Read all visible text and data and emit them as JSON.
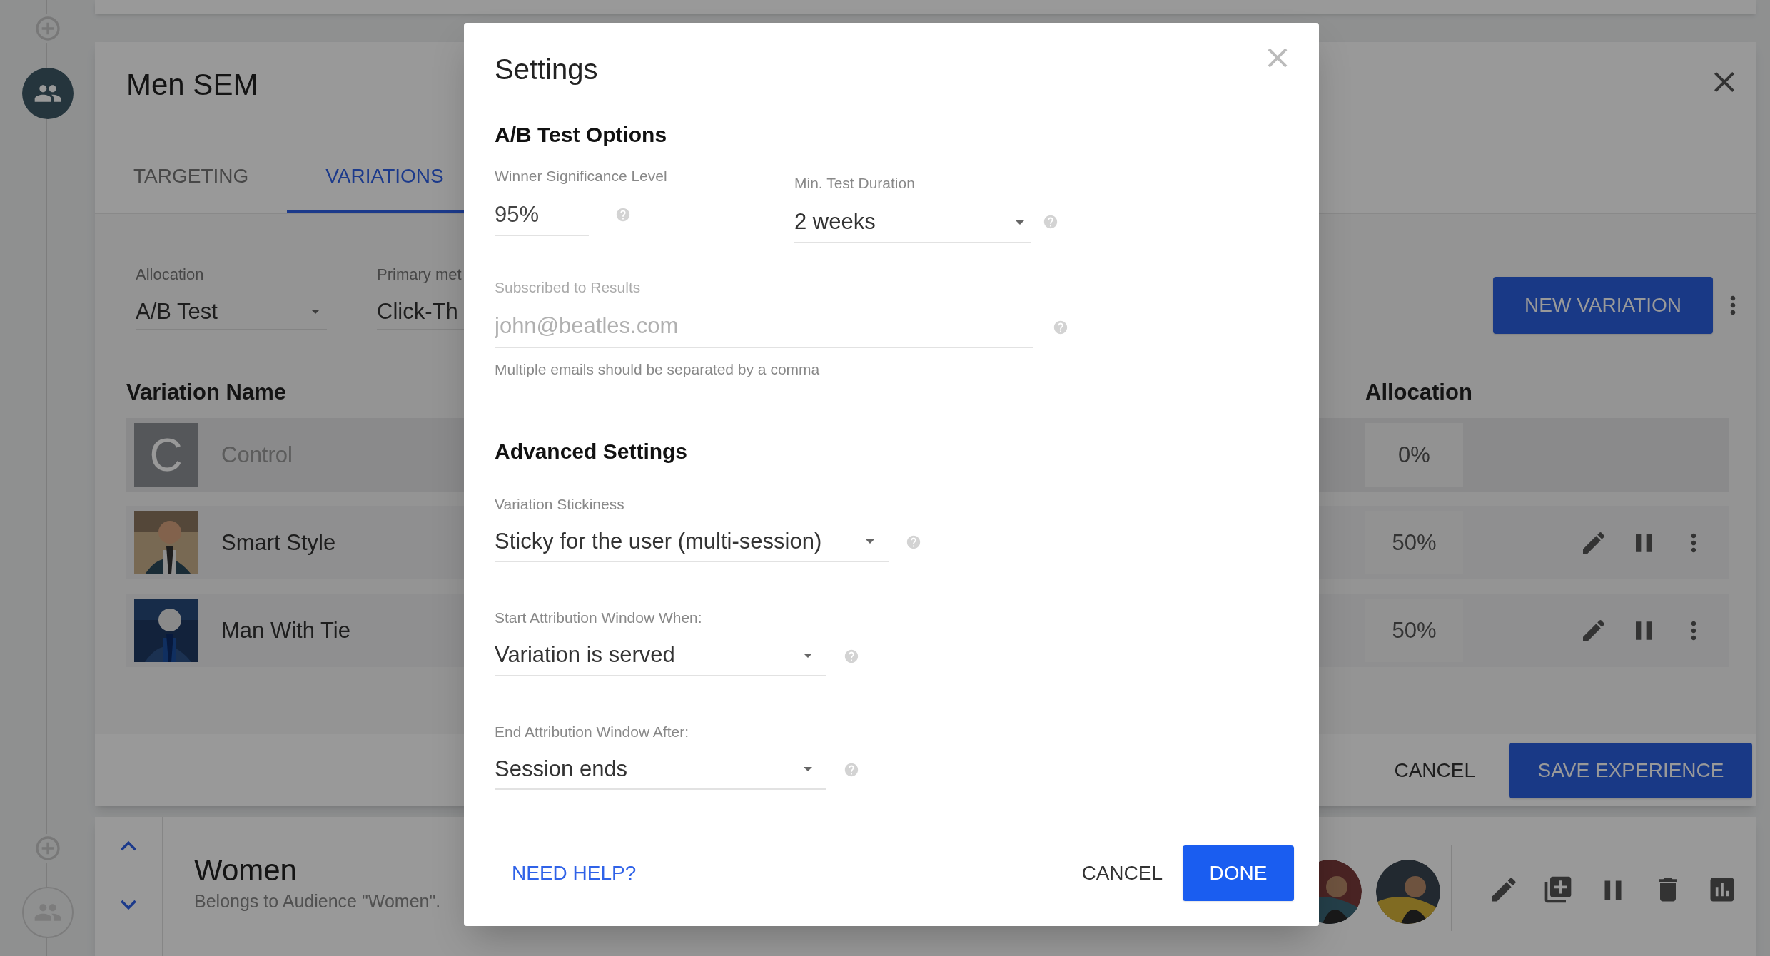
{
  "experience": {
    "title": "Men SEM",
    "tabs": [
      {
        "label": "TARGETING",
        "selected": false
      },
      {
        "label": "VARIATIONS",
        "selected": true
      }
    ],
    "allocation_field": {
      "label": "Allocation",
      "value": "A/B Test"
    },
    "primary_metric_field": {
      "label": "Primary met",
      "value": "Click-Th"
    },
    "new_variation_button": "NEW VARIATION",
    "columns": [
      "Variation Name",
      "Allocation"
    ],
    "variations": [
      {
        "name": "Control",
        "kind": "letter",
        "letter": "C",
        "allocation": "0%",
        "disabled": true
      },
      {
        "name": "Smart Style",
        "kind": "picture",
        "allocation": "50%",
        "disabled": false
      },
      {
        "name": "Man With Tie",
        "kind": "picture",
        "allocation": "50%",
        "disabled": false
      }
    ],
    "cancel_button": "CANCEL",
    "save_button": "SAVE EXPERIENCE"
  },
  "next_experience": {
    "title": "Women",
    "subtitle": "Belongs to Audience \"Women\"."
  },
  "dialog": {
    "title": "Settings",
    "ab_section": {
      "heading": "A/B Test Options",
      "significance": {
        "label": "Winner Significance Level",
        "value": "95%"
      },
      "duration": {
        "label": "Min. Test Duration",
        "value": "2 weeks"
      },
      "subscribers": {
        "label": "Subscribed to Results",
        "placeholder": "john@beatles.com",
        "hint": "Multiple emails should be separated by a comma"
      }
    },
    "advanced_section": {
      "heading": "Advanced Settings",
      "fields": [
        {
          "label": "Variation Stickiness",
          "value": "Sticky for the user (multi-session)"
        },
        {
          "label": "Start Attribution Window When:",
          "value": "Variation is served"
        },
        {
          "label": "End Attribution Window After:",
          "value": "Session ends"
        }
      ]
    },
    "help_link": "NEED HELP?",
    "cancel_button": "CANCEL",
    "done_button": "DONE"
  }
}
